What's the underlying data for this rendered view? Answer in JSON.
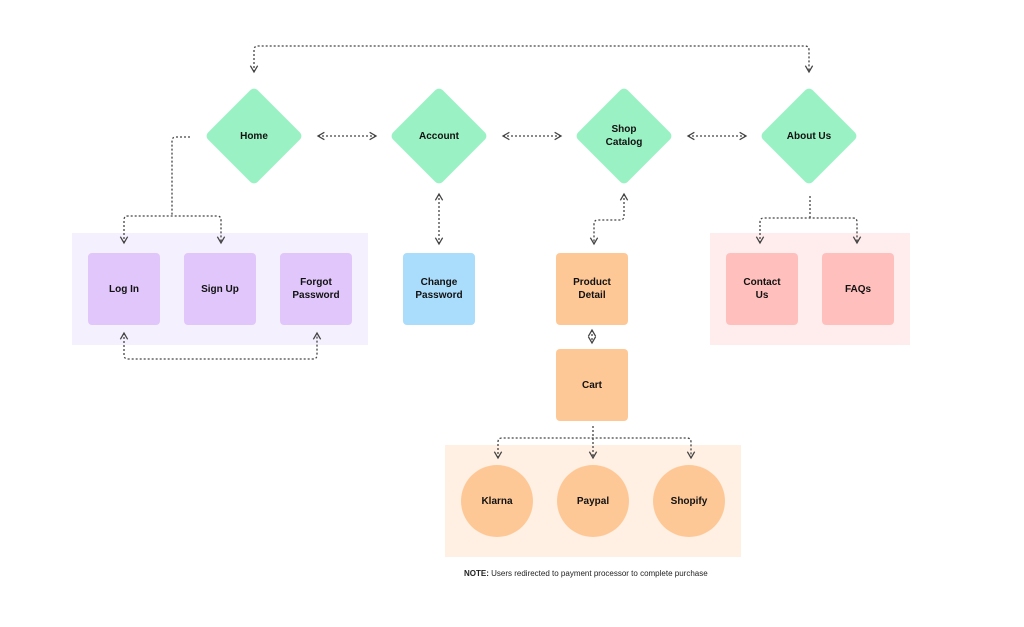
{
  "colors": {
    "nav_node": "#9af2c4",
    "auth_group_bg": "#f5f0fd",
    "auth_node": "#e0c6fa",
    "account_node": "#aadcfb",
    "shop_node": "#fec896",
    "payment_group_bg": "#fff0e3",
    "about_group_bg": "#ffecec",
    "about_node": "#ffc0bd",
    "connector": "#444444"
  },
  "nav": [
    {
      "id": "home",
      "label": "Home"
    },
    {
      "id": "account",
      "label": "Account"
    },
    {
      "id": "shop-catalog",
      "label": "Shop Catalog"
    },
    {
      "id": "about-us",
      "label": "About Us"
    }
  ],
  "auth_pages": [
    {
      "id": "log-in",
      "label": "Log In"
    },
    {
      "id": "sign-up",
      "label": "Sign Up"
    },
    {
      "id": "forgot-password",
      "label": "Forgot Password"
    }
  ],
  "account_pages": [
    {
      "id": "change-password",
      "label": "Change Password"
    }
  ],
  "shop_pages": [
    {
      "id": "product-detail",
      "label": "Product Detail"
    },
    {
      "id": "cart",
      "label": "Cart"
    }
  ],
  "payment_processors": [
    {
      "id": "klarna",
      "label": "Klarna"
    },
    {
      "id": "paypal",
      "label": "Paypal"
    },
    {
      "id": "shopify",
      "label": "Shopify"
    }
  ],
  "about_pages": [
    {
      "id": "contact-us",
      "label": "Contact Us"
    },
    {
      "id": "faqs",
      "label": "FAQs"
    }
  ],
  "note": {
    "prefix": "NOTE:",
    "text": " Users redirected to payment processor to complete purchase"
  }
}
